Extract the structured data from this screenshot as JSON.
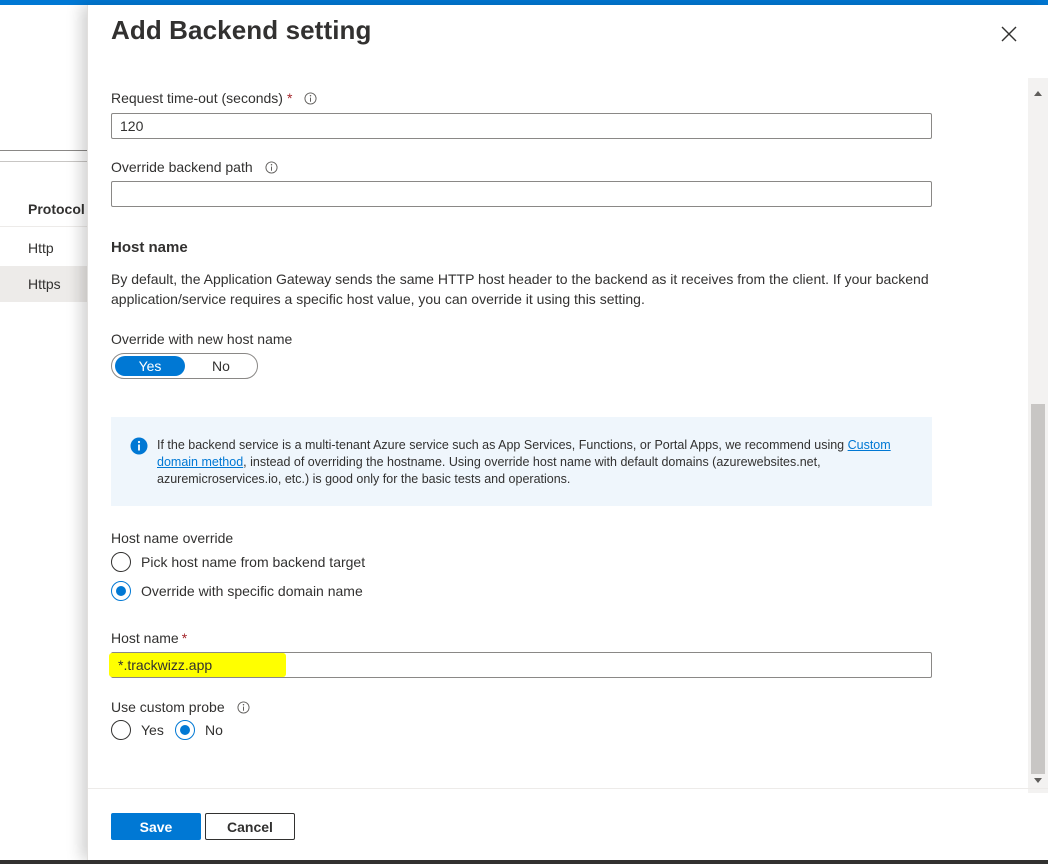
{
  "background_page": {
    "table_header": "Protocol",
    "rows": [
      "Http",
      "Https"
    ]
  },
  "blade": {
    "title": "Add Backend setting"
  },
  "request_timeout": {
    "label": "Request time-out (seconds)",
    "required": "*",
    "value": "120"
  },
  "override_path": {
    "label": "Override backend path",
    "value": ""
  },
  "host_name_section": {
    "title": "Host name",
    "description": "By default, the Application Gateway sends the same HTTP host header to the backend as it receives from the client. If your backend application/service requires a specific host value, you can override it using this setting."
  },
  "override_host_toggle": {
    "label": "Override with new host name",
    "yes": "Yes",
    "no": "No",
    "selected": "Yes"
  },
  "info_box": {
    "text_before": "If the backend service is a multi-tenant Azure service such as App Services, Functions, or Portal Apps, we recommend using ",
    "link": "Custom domain method",
    "text_after": ", instead of overriding the hostname. Using override host name with default domains (azurewebsites.net, azuremicroservices.io, etc.) is good only for the basic tests and operations."
  },
  "host_override": {
    "label": "Host name override",
    "options": [
      "Pick host name from backend target",
      "Override with specific domain name"
    ],
    "selected": "Override with specific domain name"
  },
  "host_name_field": {
    "label": "Host name",
    "required": "*",
    "value": "*.trackwizz.app"
  },
  "custom_probe": {
    "label": "Use custom probe",
    "options": [
      "Yes",
      "No"
    ],
    "selected": "No"
  },
  "footer": {
    "save_label": "Save",
    "cancel_label": "Cancel"
  },
  "colors": {
    "accent": "#0078d4",
    "required": "#a4262c",
    "highlight": "#ffff00",
    "info_background": "#eff6fc"
  }
}
